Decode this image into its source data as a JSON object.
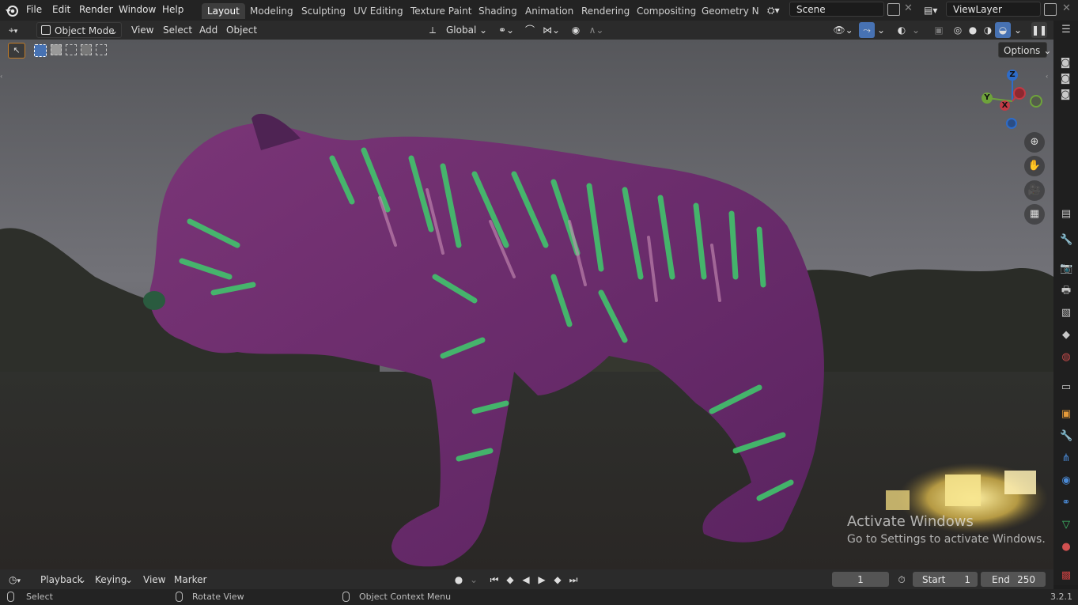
{
  "topbar": {
    "menus": [
      "File",
      "Edit",
      "Render",
      "Window",
      "Help"
    ],
    "workspaces": [
      "Layout",
      "Modeling",
      "Sculpting",
      "UV Editing",
      "Texture Paint",
      "Shading",
      "Animation",
      "Rendering",
      "Compositing",
      "Geometry Noc"
    ],
    "active_workspace": "Layout",
    "scene": "Scene",
    "view_layer": "ViewLayer"
  },
  "header": {
    "mode": "Object Mode",
    "menus": [
      "View",
      "Select",
      "Add",
      "Object"
    ],
    "orientation": "Global",
    "options": "Options"
  },
  "gizmo": {
    "z": "Z",
    "y": "Y",
    "x": "X"
  },
  "watermark": {
    "title": "Activate Windows",
    "subtitle": "Go to Settings to activate Windows."
  },
  "timeline": {
    "menus": [
      "Playback",
      "Keying",
      "View",
      "Marker"
    ],
    "current_frame": "1",
    "start_label": "Start",
    "start": "1",
    "end_label": "End",
    "end": "250"
  },
  "status": {
    "select": "Select",
    "rotate": "Rotate View",
    "context": "Object Context Menu",
    "version": "3.2.1"
  },
  "icons": {
    "logo": "blender-logo-icon",
    "shield": "viewport-gizmo-icon",
    "pause": "pause-icon",
    "zoom": "zoom-icon",
    "pan": "hand-icon",
    "camera": "camera-icon",
    "grid": "perspective-grid-icon"
  },
  "colors": {
    "accent": "#4772b3",
    "x_axis": "#c13a45",
    "y_axis": "#6ea33b",
    "z_axis": "#2e6cc9",
    "tiger_purple": "#6b2a6f",
    "stripe_green": "#3ec96a"
  }
}
